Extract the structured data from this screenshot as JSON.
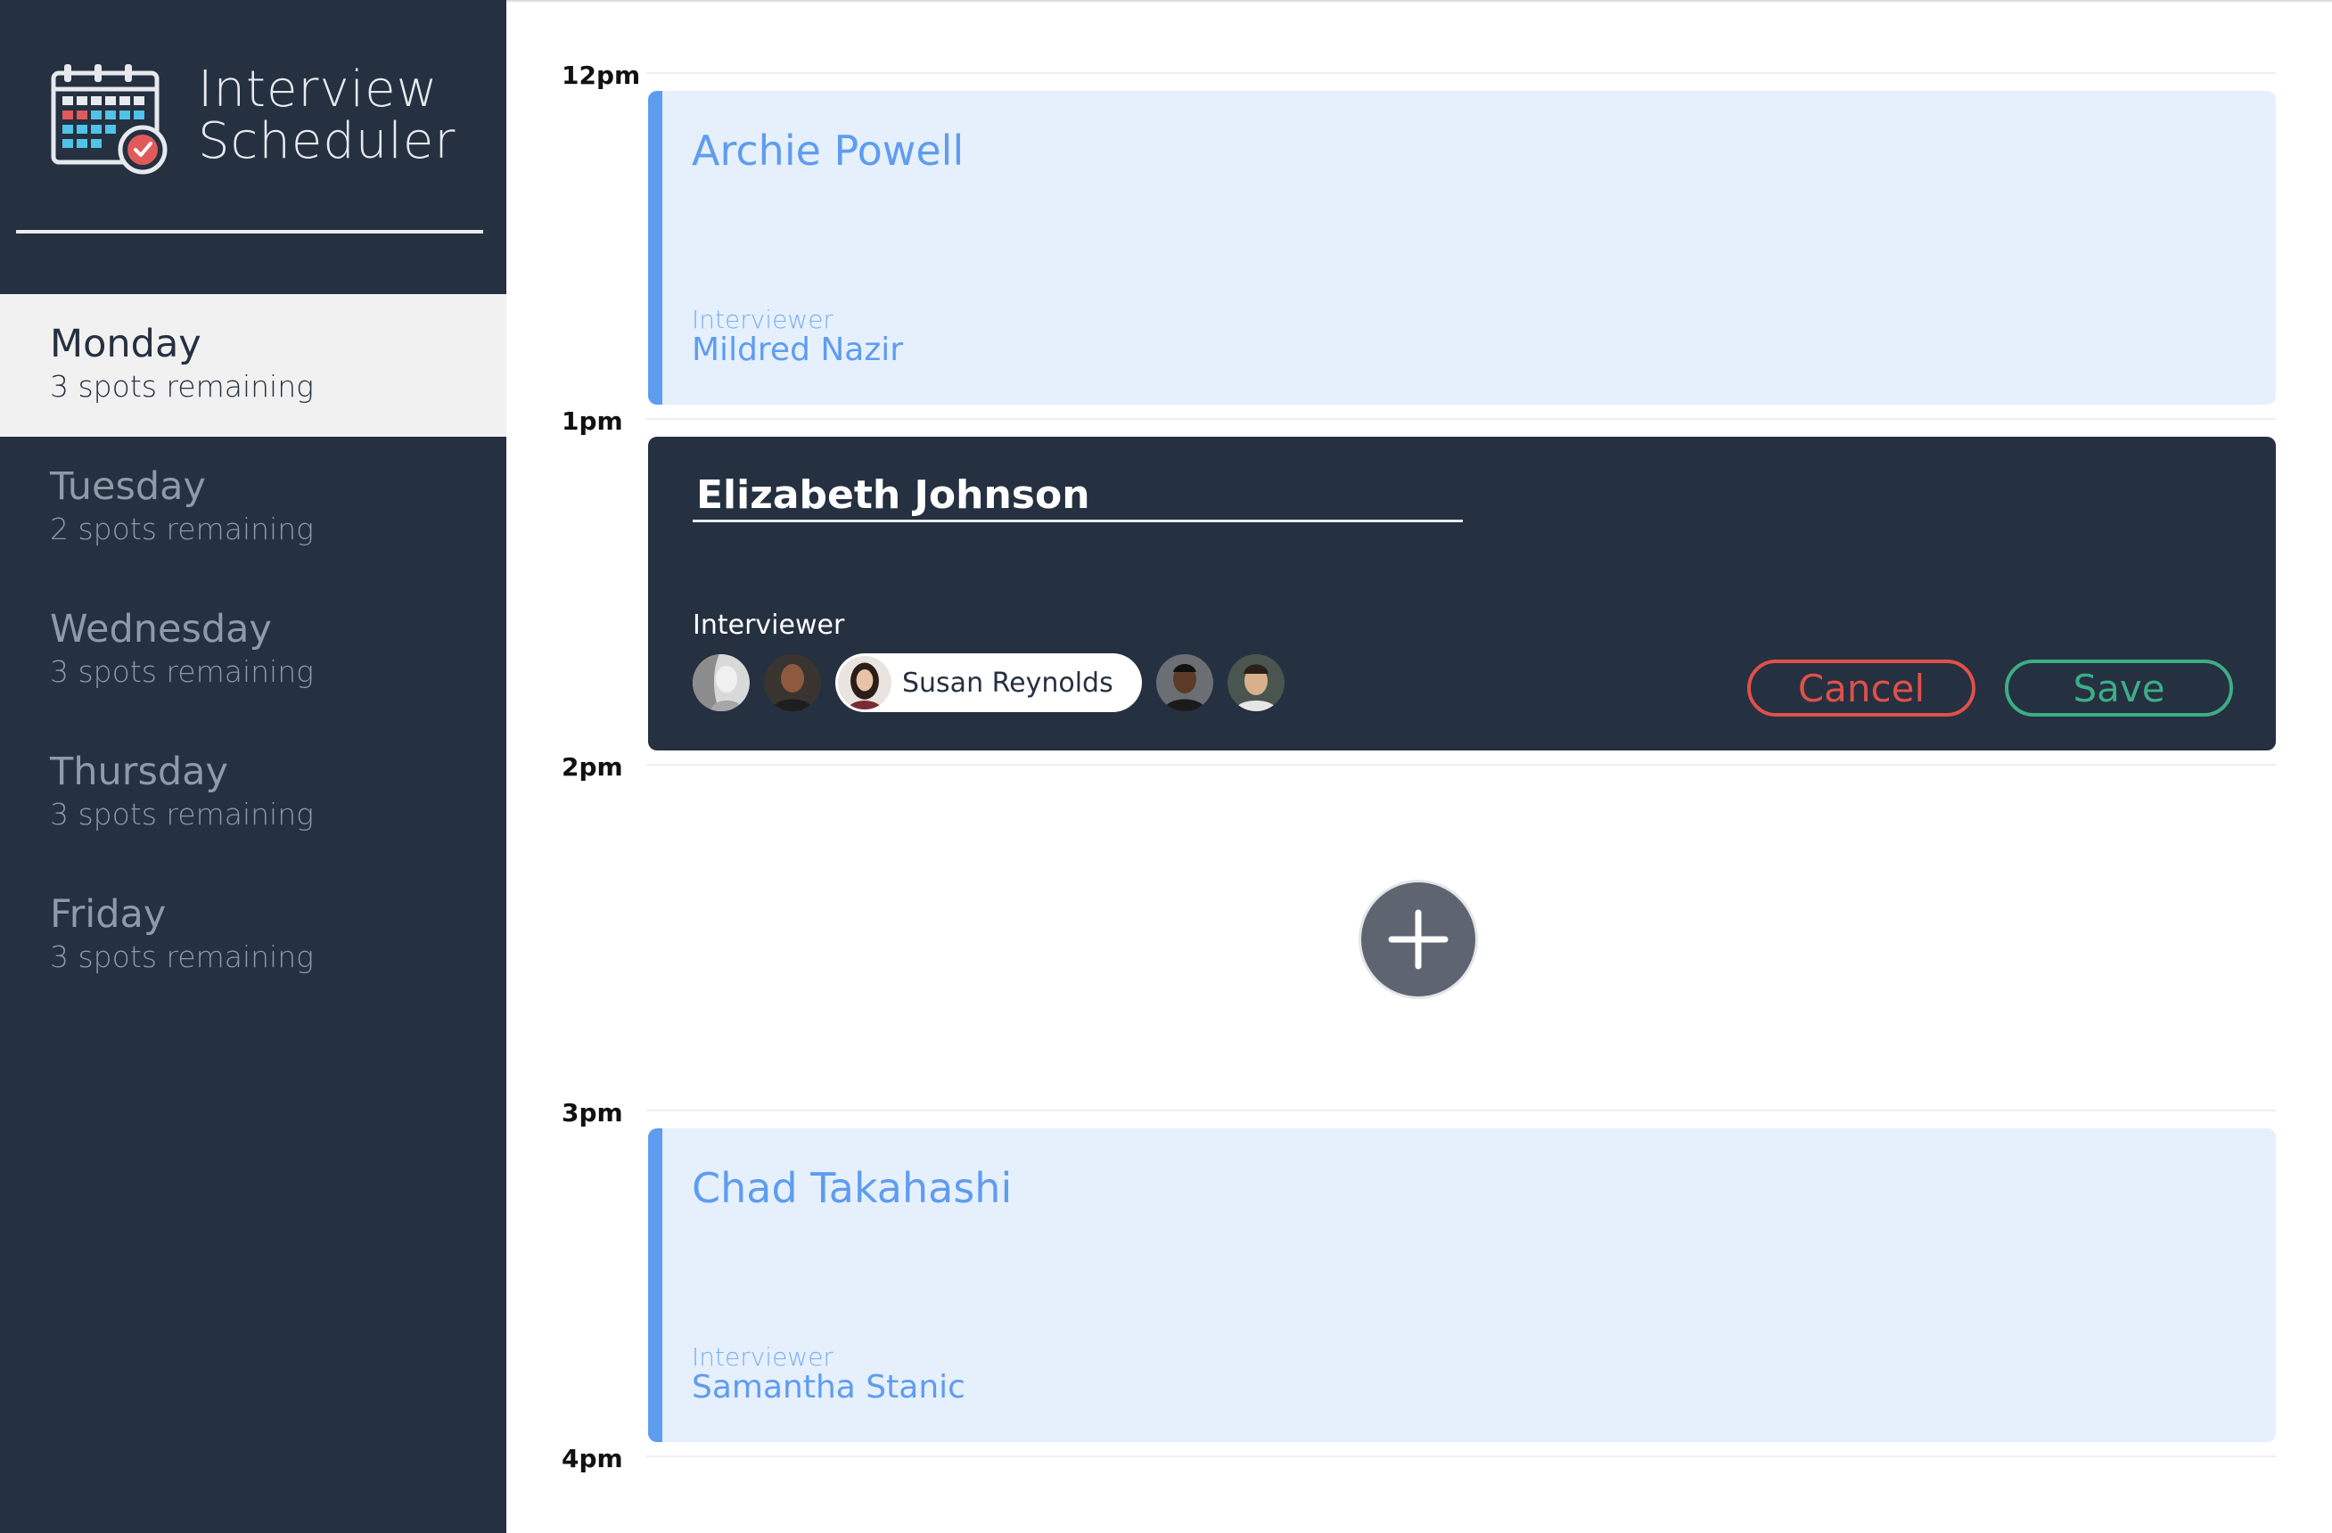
{
  "app": {
    "title_line1": "Interview",
    "title_line2": "Scheduler",
    "logo_icon": "calendar-check-icon"
  },
  "sidebar": {
    "days": [
      {
        "name": "Monday",
        "spots": "3 spots remaining",
        "selected": true
      },
      {
        "name": "Tuesday",
        "spots": "2 spots remaining",
        "selected": false
      },
      {
        "name": "Wednesday",
        "spots": "3 spots remaining",
        "selected": false
      },
      {
        "name": "Thursday",
        "spots": "3 spots remaining",
        "selected": false
      },
      {
        "name": "Friday",
        "spots": "3 spots remaining",
        "selected": false
      }
    ]
  },
  "schedule": {
    "times": [
      "12pm",
      "1pm",
      "2pm",
      "3pm",
      "4pm"
    ],
    "appointments": [
      {
        "time": "12pm",
        "student": "Archie Powell",
        "interviewer_label": "Interviewer",
        "interviewer": "Mildred Nazir"
      },
      {
        "time": "3pm",
        "student": "Chad Takahashi",
        "interviewer_label": "Interviewer",
        "interviewer": "Samantha Stanic"
      }
    ],
    "editor": {
      "time": "1pm",
      "student_value": "Elizabeth Johnson",
      "interviewer_label": "Interviewer",
      "selected_interviewer": "Susan Reynolds",
      "interviewer_avatars": [
        "avatar-1",
        "avatar-2",
        "avatar-susan-reynolds",
        "avatar-4",
        "avatar-5"
      ],
      "cancel_label": "Cancel",
      "save_label": "Save"
    },
    "add_button_icon": "plus-icon"
  },
  "colors": {
    "sidebar_bg": "#253040",
    "selected_day_bg": "#f1f1f1",
    "appointment_bg": "#e6f0fd",
    "appointment_accent": "#5e9cf0",
    "cancel": "#e0504a",
    "save": "#3dad87",
    "add_button": "#5f6570"
  }
}
